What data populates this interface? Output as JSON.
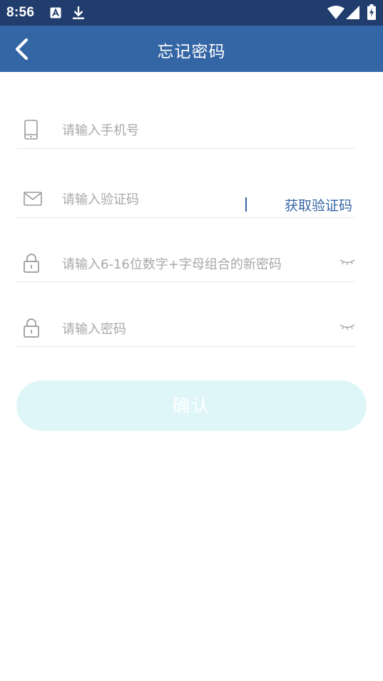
{
  "status_bar": {
    "time": "8:56",
    "icons": [
      "notification-a-icon",
      "download-icon",
      "wifi-icon",
      "cell-signal-icon",
      "battery-charging-icon"
    ]
  },
  "app_bar": {
    "title": "忘记密码",
    "back_icon": "chevron-left-icon"
  },
  "form": {
    "phone": {
      "placeholder": "请输入手机号",
      "value": "",
      "icon": "phone-icon"
    },
    "verification_code": {
      "placeholder": "请输入验证码",
      "value": "",
      "icon": "mail-icon",
      "get_code_label": "获取验证码"
    },
    "new_password": {
      "placeholder": "请输入6-16位数字+字母组合的新密码",
      "value": "",
      "icon": "lock-icon",
      "visibility_icon": "eye-closed-icon"
    },
    "confirm_password": {
      "placeholder": "请输入密码",
      "value": "",
      "icon": "lock-icon",
      "visibility_icon": "eye-closed-icon"
    }
  },
  "confirm_button": {
    "label": "确认"
  },
  "colors": {
    "status_bar": "#213d6e",
    "app_bar": "#3465a4",
    "accent": "#3465a4",
    "confirm_disabled_bg": "#dff6f8",
    "placeholder": "#a8a8a8",
    "divider": "#e6e6e6"
  }
}
